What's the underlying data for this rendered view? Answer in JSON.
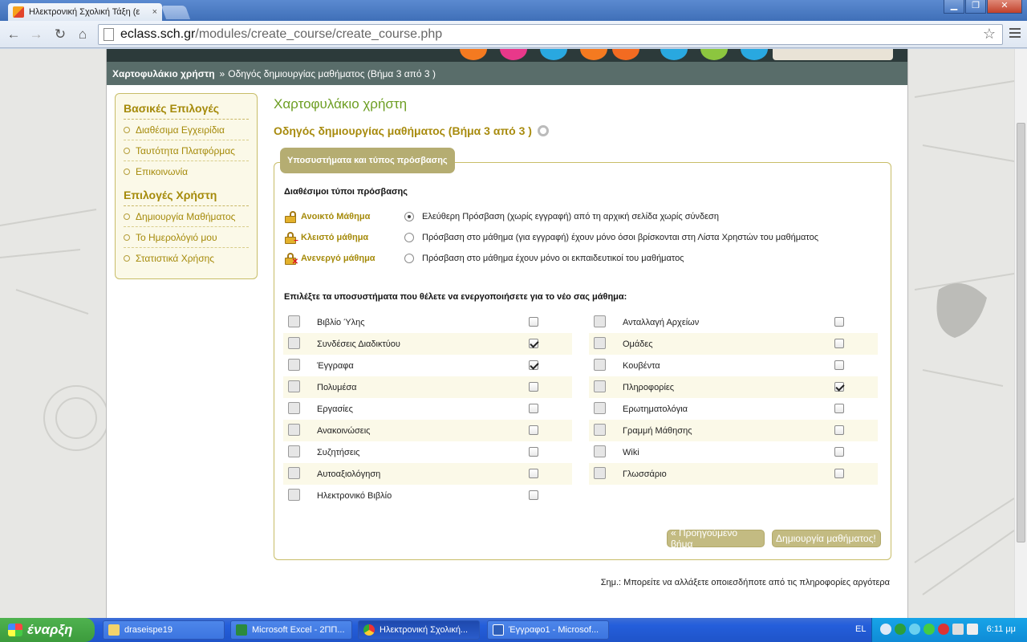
{
  "browser": {
    "tab_title": "Ηλεκτρονική Σχολική Τάξη (ε",
    "tab_close": "×",
    "window_controls": {
      "minimize": "▁",
      "maximize": "❐",
      "close": "✕"
    },
    "nav": {
      "back": "←",
      "forward": "→",
      "reload": "↻",
      "home": "⌂"
    },
    "url_host": "eclass.sch.gr",
    "url_path": "/modules/create_course/create_course.php",
    "bookmark_star": "☆"
  },
  "breadcrumb": {
    "home": "Χαρτοφυλάκιο χρήστη",
    "separator": "»",
    "current": "Οδηγός δημιουργίας μαθήματος (Βήμα 3 από 3 )"
  },
  "sidebar": {
    "basic_heading": "Βασικές Επιλογές",
    "basic_items": [
      "Διαθέσιμα Εγχειρίδια",
      "Ταυτότητα Πλατφόρμας",
      "Επικοινωνία"
    ],
    "user_heading": "Επιλογές Χρήστη",
    "user_items": [
      "Δημιουργία Μαθήματος",
      "Το Ημερολόγιό μου",
      "Στατιστικά Χρήσης"
    ]
  },
  "main": {
    "title": "Χαρτοφυλάκιο χρήστη",
    "wizard_title": "Οδηγός δημιουργίας μαθήματος (Βήμα 3 από 3 )",
    "legend": "Υποσυστήματα και τύπος πρόσβασης",
    "access_heading": "Διαθέσιμοι τύποι πρόσβασης",
    "access_types": [
      {
        "name": "Ανοικτό Μάθημα",
        "desc": "Ελεύθερη Πρόσβαση (χωρίς εγγραφή) από τη αρχική σελίδα χωρίς σύνδεση",
        "selected": true
      },
      {
        "name": "Κλειστό μάθημα",
        "desc": "Πρόσβαση στο μάθημα (για εγγραφή) έχουν μόνο όσοι βρίσκονται στη Λίστα Χρηστών του μαθήματος",
        "selected": false
      },
      {
        "name": "Ανενεργό μάθημα",
        "desc": "Πρόσβαση στο μάθημα έχουν μόνο οι εκπαιδευτικοί του μαθήματος",
        "selected": false
      }
    ],
    "modules_heading": "Επιλέξτε τα υποσυστήματα που θέλετε να ενεργοποιήσετε για το νέο σας μάθημα:",
    "modules_left": [
      {
        "label": "Βιβλίο Ύλης",
        "icon": "calendar-icon",
        "checked": false
      },
      {
        "label": "Συνδέσεις Διαδικτύου",
        "icon": "link-icon",
        "checked": true
      },
      {
        "label": "Έγγραφα",
        "icon": "folder-icon",
        "checked": true
      },
      {
        "label": "Πολυμέσα",
        "icon": "multimedia-icon",
        "checked": false
      },
      {
        "label": "Εργασίες",
        "icon": "book-icon",
        "checked": false
      },
      {
        "label": "Ανακοινώσεις",
        "icon": "clock-icon",
        "checked": false
      },
      {
        "label": "Συζητήσεις",
        "icon": "chat-bubble-icon",
        "checked": false
      },
      {
        "label": "Αυτοαξιολόγηση",
        "icon": "pencil-icon",
        "checked": false
      },
      {
        "label": "Ηλεκτρονικό Βιβλίο",
        "icon": "ebook-icon",
        "checked": false
      }
    ],
    "modules_right": [
      {
        "label": "Ανταλλαγή Αρχείων",
        "icon": "file-exchange-icon",
        "checked": false
      },
      {
        "label": "Ομάδες",
        "icon": "group-icon",
        "checked": false
      },
      {
        "label": "Κουβέντα",
        "icon": "conversation-icon",
        "checked": false
      },
      {
        "label": "Πληροφορίες",
        "icon": "tag-icon",
        "checked": true
      },
      {
        "label": "Ερωτηματολόγια",
        "icon": "questionnaire-icon",
        "checked": false
      },
      {
        "label": "Γραμμή Μάθησης",
        "icon": "footsteps-icon",
        "checked": false
      },
      {
        "label": "Wiki",
        "icon": "wiki-icon",
        "checked": false
      },
      {
        "label": "Γλωσσάριο",
        "icon": "glossary-icon",
        "checked": false
      }
    ],
    "prev_button": "« Προηγούμενο βήμα",
    "create_button": "Δημιουργία μαθήματος!",
    "note": "Σημ.: Μπορείτε να αλλάξετε οποιεσδήποτε από τις πληροφορίες αργότερα"
  },
  "taskbar": {
    "start": "έναρξη",
    "tasks": [
      {
        "label": "draseispe19",
        "icon": "folder-icon",
        "active": false
      },
      {
        "label": "Microsoft Excel - 2ΠΠ...",
        "icon": "excel-icon",
        "active": false
      },
      {
        "label": "Ηλεκτρονική Σχολική...",
        "icon": "chrome-icon",
        "active": true
      },
      {
        "label": "Έγγραφο1 - Microsof...",
        "icon": "word-icon",
        "active": false
      }
    ],
    "language": "EL",
    "clock": "6:11 μμ"
  },
  "colors": {
    "accent_green": "#6d9e23",
    "accent_gold": "#a58a0a",
    "breadcrumb_bg": "#596d6a",
    "button_bg": "#c3bb82"
  }
}
